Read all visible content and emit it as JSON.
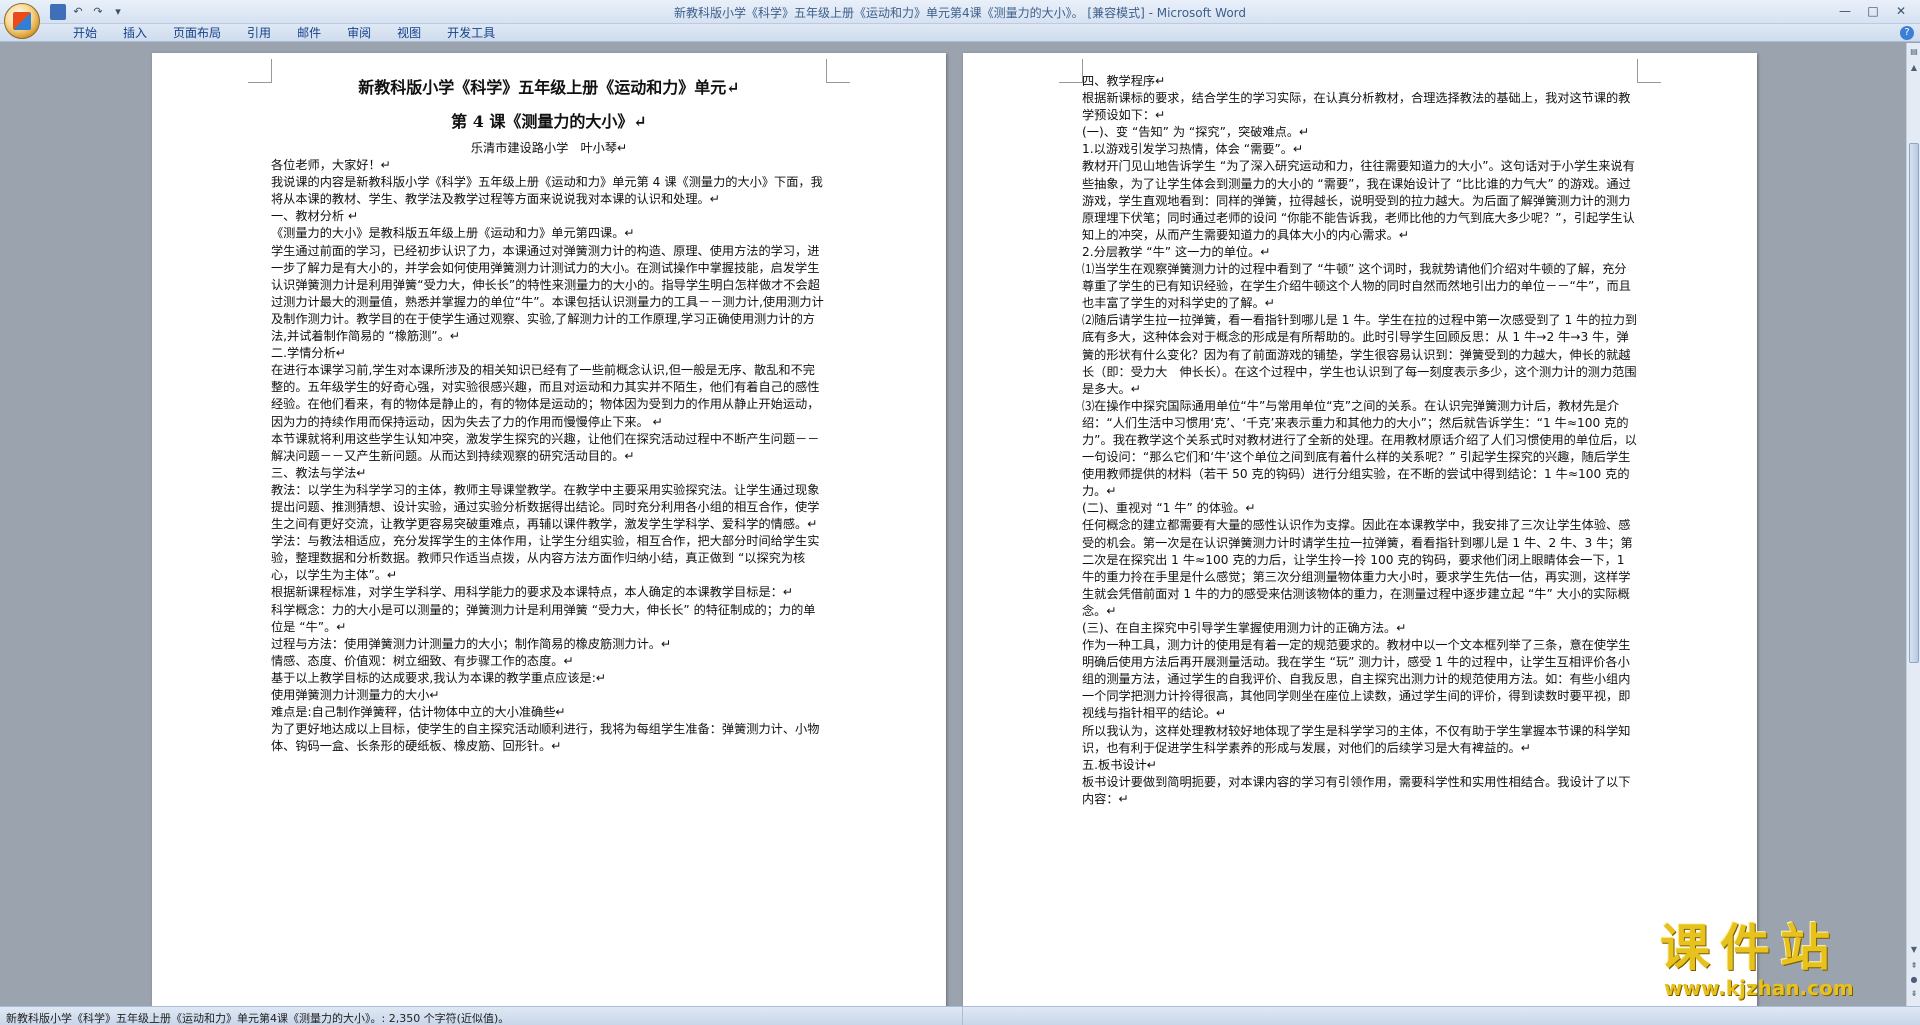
{
  "window": {
    "title": "新教科版小学《科学》五年级上册《运动和力》单元第4课《测量力的大小》。 [兼容模式] - Microsoft Word",
    "controls": [
      "—",
      "□",
      "✕"
    ]
  },
  "quick_access": [
    "save-icon",
    "undo-icon",
    "redo-icon",
    "customize-icon"
  ],
  "ribbon": {
    "tabs": [
      "开始",
      "插入",
      "页面布局",
      "引用",
      "邮件",
      "审阅",
      "视图",
      "开发工具"
    ]
  },
  "page_left": {
    "title_line1": "新教科版小学《科学》五年级上册《运动和力》单元↵",
    "title_line2": "第 4 课《测量力的大小》↵",
    "author": "乐清市建设路小学　叶小琴↵",
    "paragraphs": [
      "各位老师，大家好！↵",
      "我说课的内容是新教科版小学《科学》五年级上册《运动和力》单元第 4 课《测量力的大小》下面，我将从本课的教材、学生、教学法及教学过程等方面来说说我对本课的认识和处理。↵",
      "一、教材分析 ↵",
      "《测量力的大小》是教科版五年级上册《运动和力》单元第四课。↵",
      "学生通过前面的学习，已经初步认识了力，本课通过对弹簧测力计的构造、原理、使用方法的学习，进一步了解力是有大小的，并学会如何使用弹簧测力计测试力的大小。在测试操作中掌握技能，启发学生认识弹簧测力计是利用弹簧“受力大，伸长长”的特性来测量力的大小的。指导学生明白怎样做才不会超过测力计最大的测量值，熟悉并掌握力的单位“牛”。本课包括认识测量力的工具－－测力计,使用测力计及制作测力计。教学目的在于使学生通过观察、实验,了解测力计的工作原理,学习正确使用测力计的方法,并试着制作简易的 “橡筋测”。↵",
      "二.学情分析↵",
      "在进行本课学习前,学生对本课所涉及的相关知识已经有了一些前概念认识,但一般是无序、散乱和不完整的。五年级学生的好奇心强，对实验很感兴趣，而且对运动和力其实并不陌生，他们有着自己的感性经验。在他们看来，有的物体是静止的，有的物体是运动的；物体因为受到力的作用从静止开始运动，因为力的持续作用而保持运动，因为失去了力的作用而慢慢停止下来。 ↵",
      "本节课就将利用这些学生认知冲突，激发学生探究的兴趣，让他们在探究活动过程中不断产生问题－－解决问题－－又产生新问题。从而达到持续观察的研究活动目的。↵",
      "三、教法与学法↵",
      "教法：以学生为科学学习的主体，教师主导课堂教学。在教学中主要采用实验探究法。让学生通过现象提出问题、推测猜想、设计实验，通过实验分析数据得出结论。同时充分利用各小组的相互合作，使学生之间有更好交流，让教学更容易突破重难点，再辅以课件教学，激发学生学科学、爱科学的情感。↵",
      "学法：与教法相适应，充分发挥学生的主体作用，让学生分组实验，相互合作，把大部分时间给学生实验，整理数据和分析数据。教师只作适当点拨，从内容方法方面作归纳小结，真正做到 “以探究为核心，以学生为主体”。↵",
      "根据新课程标准，对学生学科学、用科学能力的要求及本课特点，本人确定的本课教学目标是：↵",
      "科学概念：力的大小是可以测量的；弹簧测力计是利用弹簧 “受力大，伸长长” 的特征制成的；力的单位是 “牛”。↵",
      "过程与方法：使用弹簧测力计测量力的大小；制作简易的橡皮筋测力计。↵",
      "情感、态度、价值观：树立细致、有步骤工作的态度。↵",
      "基于以上教学目标的达成要求,我认为本课的教学重点应该是:↵",
      "  使用弹簧测力计测量力的大小↵",
      "难点是:自己制作弹簧秤，估计物体中立的大小准确些↵",
      "为了更好地达成以上目标，使学生的自主探究活动顺利进行，我将为每组学生准备：弹簧测力计、小物体、钩码一盒、长条形的硬纸板、橡皮筋、回形针。↵"
    ]
  },
  "page_right": {
    "paragraphs": [
      "四、教学程序↵",
      "根据新课标的要求，结合学生的学习实际，在认真分析教材，合理选择教法的基础上，我对这节课的教学预设如下：↵",
      "(一)、变 “告知” 为 “探究”，突破难点。↵",
      "1.以游戏引发学习热情，体会 “需要”。↵",
      "  教材开门见山地告诉学生 “为了深入研究运动和力，往往需要知道力的大小”。这句话对于小学生来说有些抽象，为了让学生体会到测量力的大小的 “需要”，我在课始设计了 “比比谁的力气大” 的游戏。通过游戏，学生直观地看到：同样的弹簧，拉得越长，说明受到的拉力越大。为后面了解弹簧测力计的测力原理埋下伏笔；同时通过老师的设问 “你能不能告诉我，老师比他的力气到底大多少呢？”，引起学生认知上的冲突，从而产生需要知道力的具体大小的内心需求。↵",
      "2.分层教学 “牛” 这一力的单位。↵",
      "⑴当学生在观察弹簧测力计的过程中看到了 “牛顿” 这个词时，我就势请他们介绍对牛顿的了解，充分尊重了学生的已有知识经验，在学生介绍牛顿这个人物的同时自然而然地引出力的单位－－“牛”，而且也丰富了学生的对科学史的了解。↵",
      "⑵随后请学生拉一拉弹簧，看一看指针到哪儿是 1 牛。学生在拉的过程中第一次感受到了 1 牛的拉力到底有多大，这种体会对于概念的形成是有所帮助的。此时引导学生回顾反思：从 1 牛→2 牛→3 牛，弹簧的形状有什么变化？因为有了前面游戏的铺垫，学生很容易认识到：弹簧受到的力越大，伸长的就越长（即：受力大　伸长长）。在这个过程中，学生也认识到了每一刻度表示多少，这个测力计的测力范围是多大。↵",
      "⑶在操作中探究国际通用单位“牛”与常用单位“克”之间的关系。在认识完弹簧测力计后，教材先是介绍：“人们生活中习惯用‘克’、‘千克’来表示重力和其他力的大小”；然后就告诉学生：“1 牛≈100 克的力”。我在教学这个关系式时对教材进行了全新的处理。在用教材原话介绍了人们习惯使用的单位后，以一句设问：“那么它们和‘牛’这个单位之间到底有着什么样的关系呢？” 引起学生探究的兴趣，随后学生使用教师提供的材料（若干 50 克的钩码）进行分组实验，在不断的尝试中得到结论：1 牛≈100 克的力。↵",
      "(二)、重视对 “1 牛” 的体验。↵",
      "任何概念的建立都需要有大量的感性认识作为支撑。因此在本课教学中，我安排了三次让学生体验、感受的机会。第一次是在认识弹簧测力计时请学生拉一拉弹簧，看看指针到哪儿是 1 牛、2 牛、3 牛；第二次是在探究出 1 牛≈100 克的力后，让学生拎一拎 100 克的钩码，要求他们闭上眼睛体会一下，1 牛的重力拎在手里是什么感觉；第三次分组测量物体重力大小时，要求学生先估一估，再实测，这样学生就会凭借前面对 1 牛的力的感受来估测该物体的重力，在测量过程中逐步建立起 “牛” 大小的实际概念。↵",
      "(三)、在自主探究中引导学生掌握使用测力计的正确方法。↵",
      "作为一种工具，测力计的使用是有着一定的规范要求的。教材中以一个文本框列举了三条，意在使学生明确后使用方法后再开展测量活动。我在学生 “玩” 测力计，感受 1 牛的过程中，让学生互相评价各小组的测量方法，通过学生的自我评价、自我反思，自主探究出测力计的规范使用方法。如：有些小组内一个同学把测力计拎得很高，其他同学则坐在座位上读数，通过学生间的评价，得到读数时要平视，即视线与指针相平的结论。↵",
      "所以我认为，这样处理教材较好地体现了学生是科学学习的主体，不仅有助于学生掌握本节课的科学知识，也有利于促进学生科学素养的形成与发展，对他们的后续学习是大有裨益的。↵",
      "五.板书设计↵",
      "板书设计要做到简明扼要，对本课内容的学习有引领作用，需要科学性和实用性相结合。我设计了以下内容：↵"
    ]
  },
  "statusbar": {
    "text": "新教科版小学《科学》五年级上册《运动和力》单元第4课《测量力的大小》。: 2,350 个字符(近似值)。"
  },
  "watermark": {
    "big": "课件站",
    "url": "www.kjzhan.com"
  },
  "colors": {
    "titlebar_text": "#3e5f8a",
    "ribbon_tab_text": "#15428b",
    "workspace_bg": "#9ba3ae",
    "watermark": "#e8c21c"
  }
}
